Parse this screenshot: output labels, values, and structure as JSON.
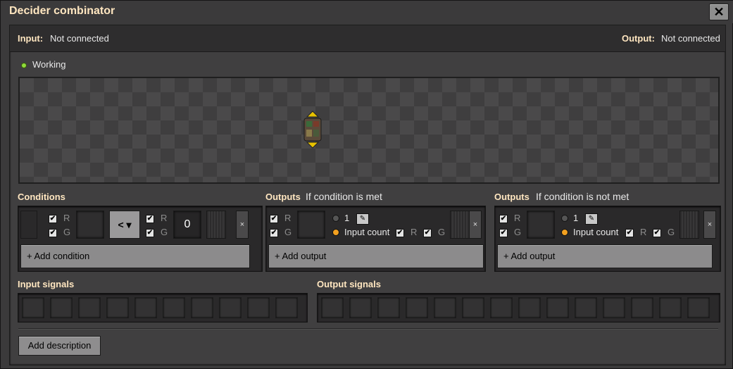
{
  "window": {
    "title": "Decider combinator",
    "close_icon": "close-icon"
  },
  "io": {
    "input_label": "Input:",
    "input_value": "Not connected",
    "output_label": "Output:",
    "output_value": "Not connected"
  },
  "status": {
    "text": "Working",
    "color": "#8fdc3a"
  },
  "conditions": {
    "header": "Conditions",
    "row": {
      "left_r": "R",
      "left_g": "G",
      "comparator": "<",
      "right_r": "R",
      "right_g": "G",
      "constant": "0",
      "remove": "×"
    },
    "add_label": "+ Add condition"
  },
  "outputs_met": {
    "header": "Outputs",
    "subheader": "If condition is met",
    "row": {
      "r": "R",
      "g": "G",
      "value": "1",
      "input_count": "Input count",
      "ic_r": "R",
      "ic_g": "G",
      "remove": "×"
    },
    "add_label": "+ Add output"
  },
  "outputs_not_met": {
    "header": "Outputs",
    "subheader": "If condition is not met",
    "row": {
      "r": "R",
      "g": "G",
      "value": "1",
      "input_count": "Input count",
      "ic_r": "R",
      "ic_g": "G",
      "remove": "×"
    },
    "add_label": "+ Add output"
  },
  "input_signals": {
    "header": "Input signals"
  },
  "output_signals": {
    "header": "Output signals"
  },
  "description": {
    "button": "Add description"
  }
}
